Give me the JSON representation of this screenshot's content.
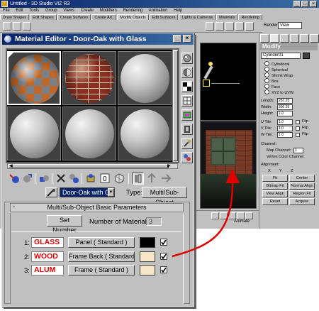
{
  "app": {
    "title": "Untitled - 3D Studio VIZ R3",
    "menu": [
      "File",
      "Edit",
      "Tools",
      "Group",
      "Views",
      "Create",
      "Modifiers",
      "Rendering",
      "Animation",
      "Help"
    ],
    "tabs": [
      "Draw Shapes",
      "Edit Shapes",
      "Create Surfaces",
      "Create A/C",
      "Modify Objects",
      "Edit Surfaces",
      "Lights & Cameras",
      "Materials",
      "Rendering"
    ],
    "render_label": "Render",
    "view_select": "View",
    "animate_label": "Animate"
  },
  "command_panel": {
    "title": "Modify",
    "object_name": "Cylinder01",
    "mapping_options": [
      {
        "label": "Cylindrical",
        "selected": false
      },
      {
        "label": "Spherical",
        "selected": false
      },
      {
        "label": "Shrink Wrap",
        "selected": false
      },
      {
        "label": "Box",
        "selected": false
      },
      {
        "label": "Face",
        "selected": false
      },
      {
        "label": "XYZ to UVW",
        "selected": false
      }
    ],
    "params": [
      {
        "label": "Length:",
        "value": "281.25"
      },
      {
        "label": "Width:",
        "value": "300.25"
      },
      {
        "label": "Height:",
        "value": "1.0"
      }
    ],
    "tiles": [
      {
        "label": "U Tile:",
        "value": "1.0",
        "flip": "Flip"
      },
      {
        "label": "V Tile:",
        "value": "1.0",
        "flip": "Flip"
      },
      {
        "label": "W Tile:",
        "value": "1.0",
        "flip": "Flip"
      }
    ],
    "channel_label": "Channel:",
    "map_channel_label": "Map Channel:",
    "map_channel_value": "1",
    "vertex_color_label": "Vertex Color Channel",
    "alignment_label": "Alignment:",
    "axes": [
      "X",
      "Y",
      "Z"
    ],
    "buttons": [
      "Fit",
      "Center",
      "Bitmap Fit",
      "Normal Align",
      "View Align",
      "Region Fit",
      "Reset",
      "Acquire"
    ]
  },
  "material_editor": {
    "title": "Material Editor - Door-Oak with Glass",
    "material_name": "Door-Oak with Glass",
    "type_label": "Type:",
    "type_value": "Multi/Sub-Object",
    "rollout_title": "Multi/Sub-Object Basic Parameters",
    "rollout_toggle": "-",
    "set_number_label": "Set Number",
    "num_materials_label": "Number of Materials:",
    "num_materials_value": "3",
    "sub_materials": [
      {
        "index": "1:",
        "name": "GLASS",
        "material": "Panel  ( Standard )",
        "color": "#000000",
        "enabled": true
      },
      {
        "index": "2:",
        "name": "WOOD",
        "material": "Frame Back  ( Standard )",
        "color": "#f5e6c8",
        "enabled": true
      },
      {
        "index": "3:",
        "name": "ALUM",
        "material": "Frame  ( Standard )",
        "color": "#f5e6c8",
        "enabled": true
      }
    ],
    "slots": [
      "checker",
      "brick",
      "plain",
      "plain",
      "plain",
      "plain"
    ]
  },
  "colors": {
    "title_bar": "#0a246a",
    "sub_material_name_text": "#e00000",
    "callout_arrow": "#e00000"
  }
}
